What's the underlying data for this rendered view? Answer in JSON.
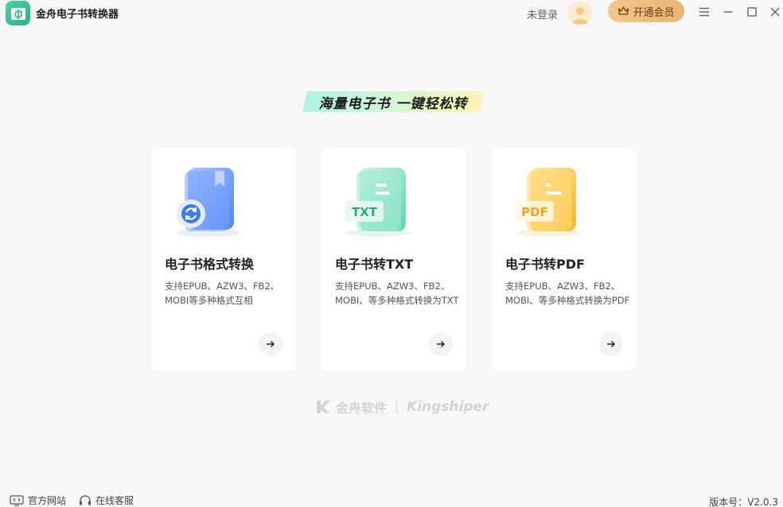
{
  "app": {
    "title": "金舟电子书转换器"
  },
  "header": {
    "login_text": "未登录",
    "vip_label": "开通会员"
  },
  "slogan": "海量电子书  一键轻松转",
  "cards": [
    {
      "title": "电子书格式转换",
      "desc": "支持EPUB、AZW3、FB2、MOBI等多种格式互相",
      "icon": "book-convert-icon",
      "accent": "#5b8ff9"
    },
    {
      "title": "电子书转TXT",
      "desc": "支持EPUB、AZW3、FB2、MOBI、等多种格式转换为TXT",
      "icon": "txt-file-icon",
      "icon_text": "TXT",
      "accent": "#4fd1a6"
    },
    {
      "title": "电子书转PDF",
      "desc": "支持EPUB、AZW3、FB2、MOBI、等多种格式转换为PDF",
      "icon": "pdf-file-icon",
      "icon_text": "PDF",
      "accent": "#f6c244"
    }
  ],
  "brand": {
    "cn": "金舟软件",
    "en": "Kingshiper"
  },
  "footer": {
    "website": "官方网站",
    "support": "在线客服",
    "version": "版本号：V2.0.3"
  },
  "colors": {
    "background": "#f7f7f8",
    "vip": "#e9b574",
    "accent": "#22b38a"
  }
}
